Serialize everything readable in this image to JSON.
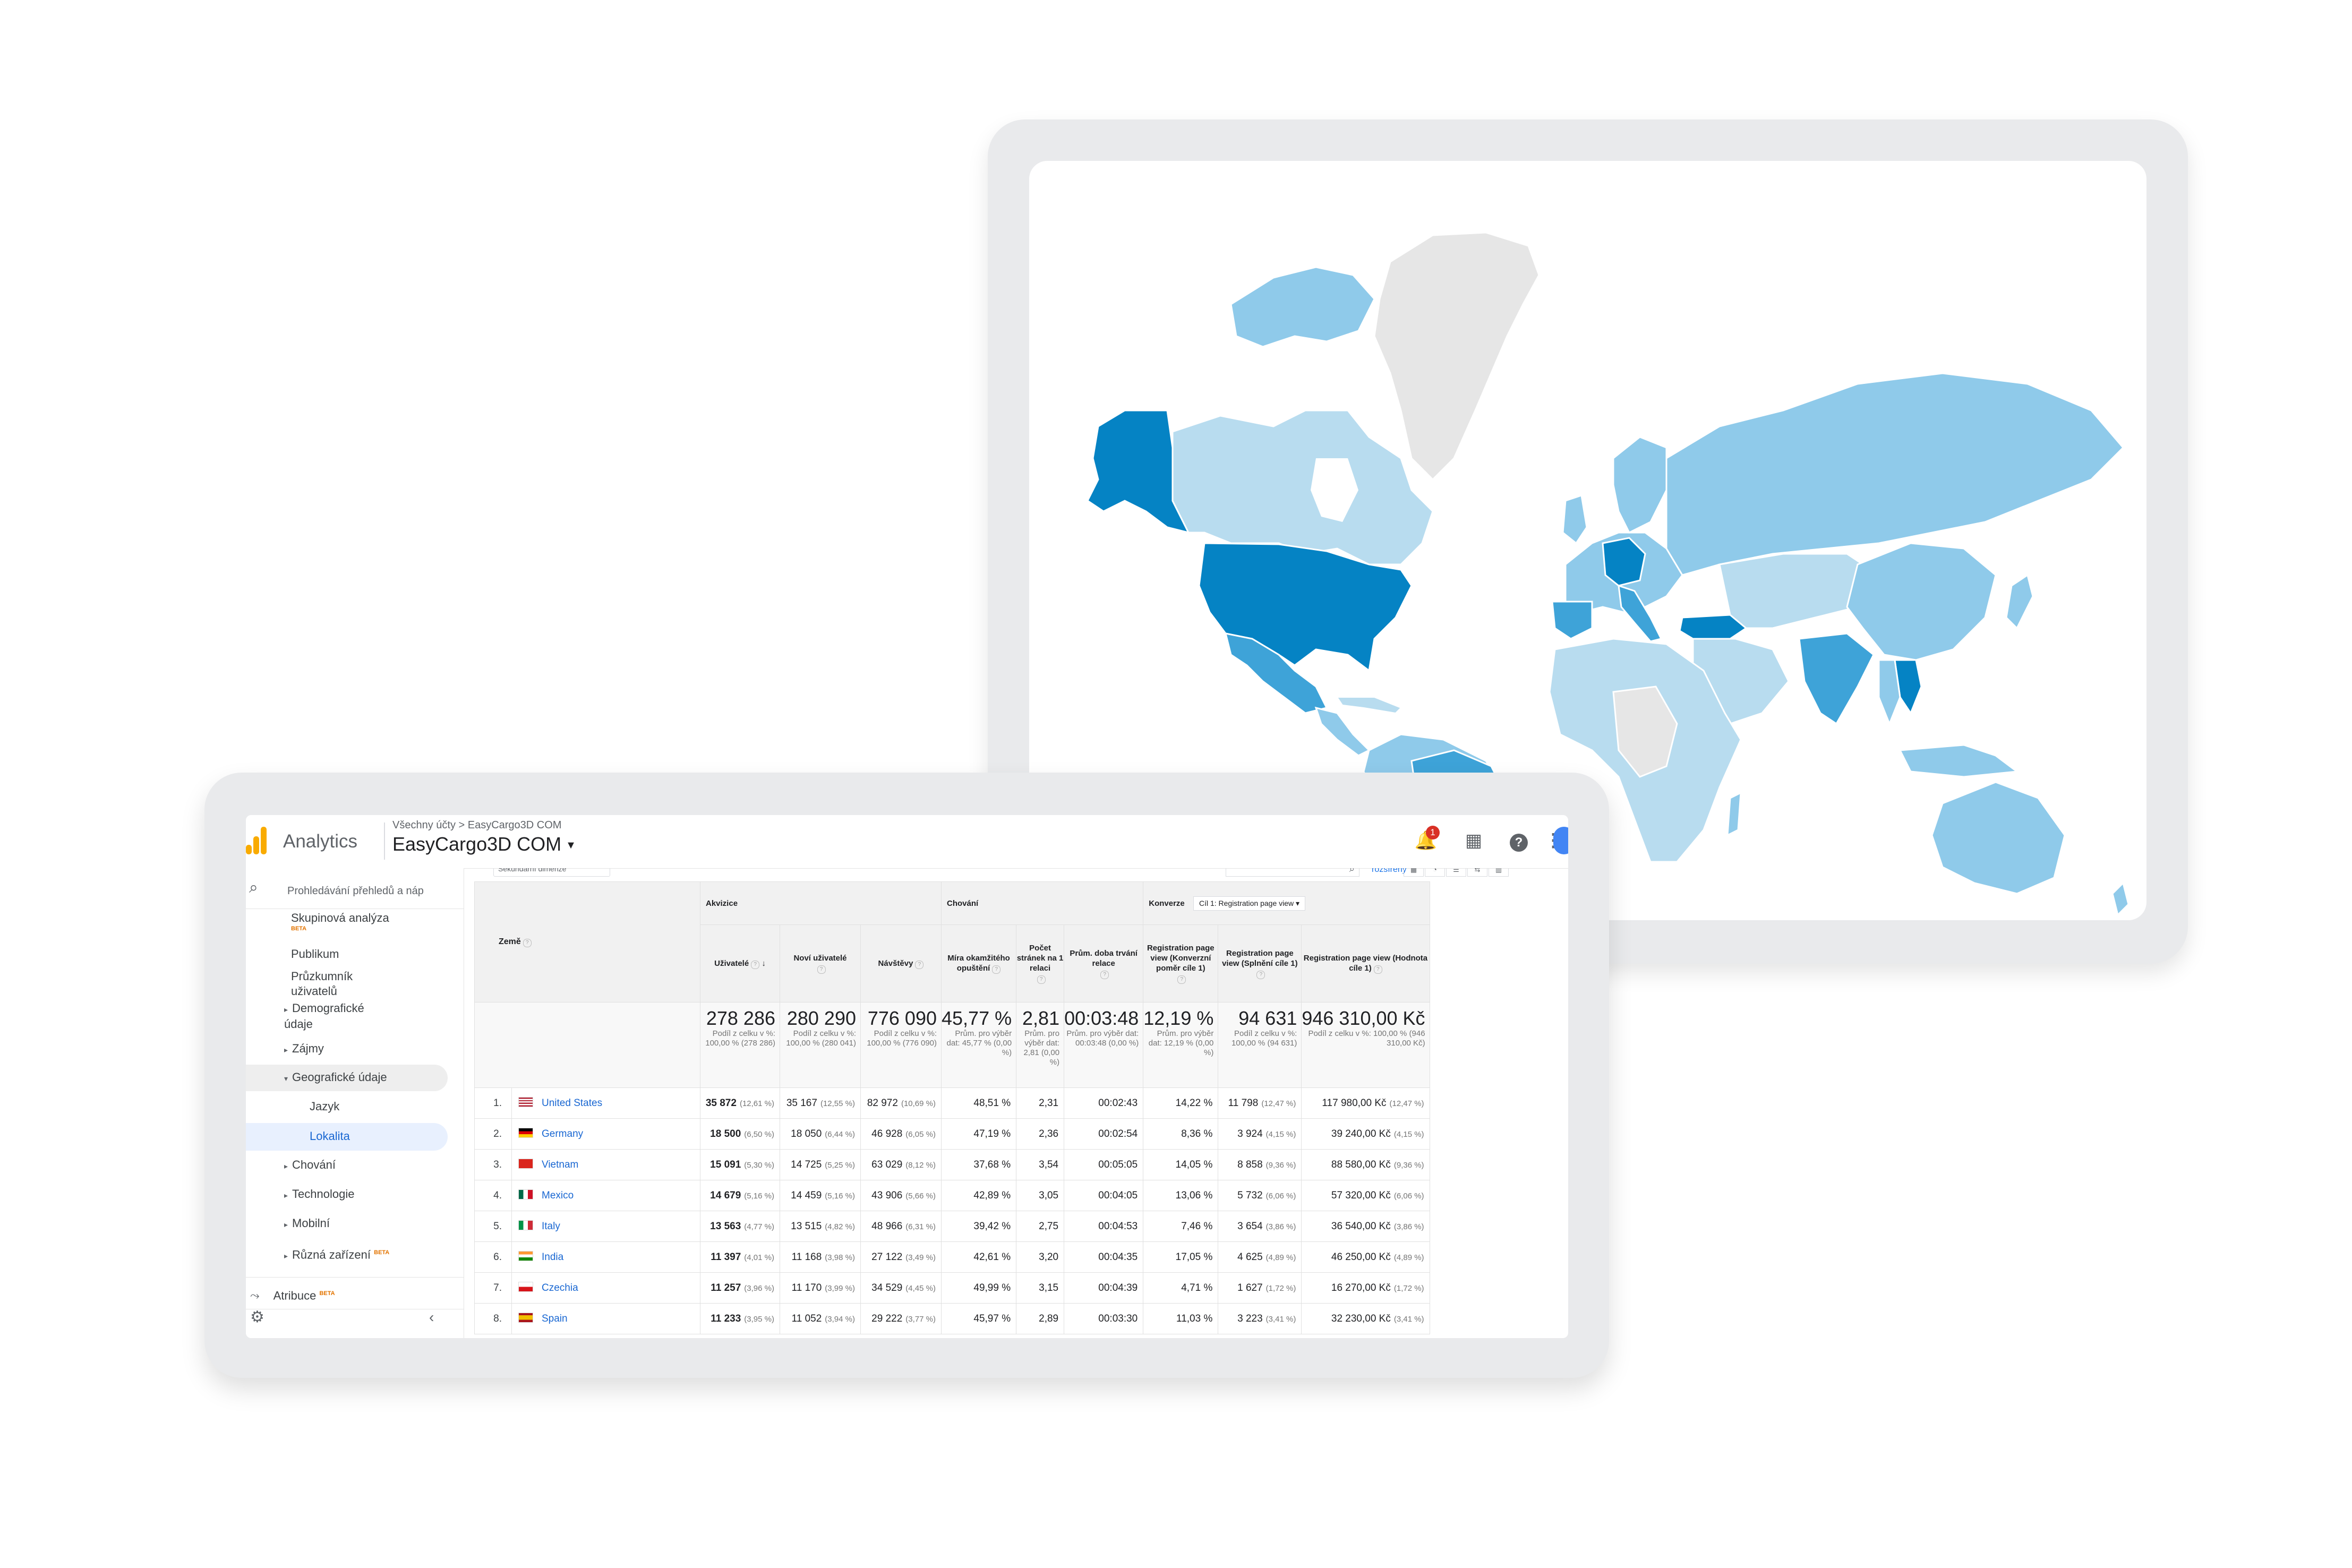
{
  "colors": {
    "map_ocean": "#ffffff",
    "map_nodata": "#e6e6e6",
    "map_light": "#b8dcef",
    "map_mid": "#8fcaea",
    "map_strong": "#3ea3d8",
    "map_max": "#0583c4",
    "ga_orange": "#f9ab00",
    "link_blue": "#1967d2"
  },
  "map": {
    "type": "choropleth-world",
    "highlighted_countries": [
      "United States",
      "Germany",
      "Vietnam",
      "Mexico",
      "Italy",
      "India",
      "Czechia",
      "Spain",
      "Turkey",
      "Brazil",
      "Canada",
      "Russia",
      "China",
      "Australia"
    ]
  },
  "header": {
    "app_name": "Analytics",
    "breadcrumb": "Všechny účty > EasyCargo3D COM",
    "account": "EasyCargo3D COM",
    "notification_count": "1",
    "icons": [
      "bell-icon",
      "apps-grid-icon",
      "help-icon",
      "more-vert-icon",
      "avatar"
    ]
  },
  "sidebar": {
    "search_placeholder": "Prohledávání přehledů a náp",
    "items": [
      {
        "label": "Skupinová analýza",
        "badge": "BETA"
      },
      {
        "label": "Publikum"
      },
      {
        "label": "Průzkumník uživatelů"
      },
      {
        "label": "Demografické údaje"
      },
      {
        "label": "Zájmy"
      },
      {
        "label": "Geografické údaje"
      },
      {
        "label": "Jazyk"
      },
      {
        "label": "Lokalita"
      },
      {
        "label": "Chování"
      },
      {
        "label": "Technologie"
      },
      {
        "label": "Mobilní"
      },
      {
        "label": "Různá zařízení",
        "badge": "BETA"
      },
      {
        "label": "Atribuce",
        "badge": "BETA"
      }
    ]
  },
  "controls": {
    "secondary_dimension": "Sekundární dimenze",
    "advanced": "rozšířený",
    "conversions_label": "Konverze",
    "goal_select": "Cíl 1: Registration page view"
  },
  "table": {
    "group_acquisition": "Akvizice",
    "group_behavior": "Chování",
    "col_country": "Země",
    "columns": [
      "Uživatelé",
      "Noví uživatelé",
      "Návštěvy",
      "Míra okamžitého opuštění",
      "Počet stránek na 1 relaci",
      "Prům. doba trvání relace",
      "Registration page view (Konverzní poměr cíle 1)",
      "Registration page view (Splnění cíle 1)",
      "Registration page view (Hodnota cíle 1)"
    ],
    "summary": [
      {
        "big": "278 286",
        "small": "Podíl z celku v %: 100,00 % (278 286)"
      },
      {
        "big": "280 290",
        "small": "Podíl z celku v %: 100,00 % (280 041)"
      },
      {
        "big": "776 090",
        "small": "Podíl z celku v %: 100,00 % (776 090)"
      },
      {
        "big": "45,77 %",
        "small": "Prům. pro výběr dat: 45,77 % (0,00 %)"
      },
      {
        "big": "2,81",
        "small": "Prům. pro výběr dat: 2,81 (0,00 %)"
      },
      {
        "big": "00:03:48",
        "small": "Prům. pro výběr dat: 00:03:48 (0,00 %)"
      },
      {
        "big": "12,19 %",
        "small": "Prům. pro výběr dat: 12,19 % (0,00 %)"
      },
      {
        "big": "94 631",
        "small": "Podíl z celku v %: 100,00 % (94 631)"
      },
      {
        "big": "946 310,00 Kč",
        "small": "Podíl z celku v %: 100,00 % (946 310,00 Kč)"
      }
    ],
    "rows": [
      {
        "rank": "1.",
        "country": "United States",
        "flag": "us",
        "users": "35 872",
        "users_pct": "(12,61 %)",
        "new": "35 167",
        "new_pct": "(12,55 %)",
        "sessions": "82 972",
        "sessions_pct": "(10,69 %)",
        "bounce": "48,51 %",
        "pages": "2,31",
        "duration": "00:02:43",
        "conv": "14,22 %",
        "compl": "11 798",
        "compl_pct": "(12,47 %)",
        "value": "117 980,00 Kč",
        "value_pct": "(12,47 %)"
      },
      {
        "rank": "2.",
        "country": "Germany",
        "flag": "de",
        "users": "18 500",
        "users_pct": "(6,50 %)",
        "new": "18 050",
        "new_pct": "(6,44 %)",
        "sessions": "46 928",
        "sessions_pct": "(6,05 %)",
        "bounce": "47,19 %",
        "pages": "2,36",
        "duration": "00:02:54",
        "conv": "8,36 %",
        "compl": "3 924",
        "compl_pct": "(4,15 %)",
        "value": "39 240,00 Kč",
        "value_pct": "(4,15 %)"
      },
      {
        "rank": "3.",
        "country": "Vietnam",
        "flag": "vn",
        "users": "15 091",
        "users_pct": "(5,30 %)",
        "new": "14 725",
        "new_pct": "(5,25 %)",
        "sessions": "63 029",
        "sessions_pct": "(8,12 %)",
        "bounce": "37,68 %",
        "pages": "3,54",
        "duration": "00:05:05",
        "conv": "14,05 %",
        "compl": "8 858",
        "compl_pct": "(9,36 %)",
        "value": "88 580,00 Kč",
        "value_pct": "(9,36 %)"
      },
      {
        "rank": "4.",
        "country": "Mexico",
        "flag": "mx",
        "users": "14 679",
        "users_pct": "(5,16 %)",
        "new": "14 459",
        "new_pct": "(5,16 %)",
        "sessions": "43 906",
        "sessions_pct": "(5,66 %)",
        "bounce": "42,89 %",
        "pages": "3,05",
        "duration": "00:04:05",
        "conv": "13,06 %",
        "compl": "5 732",
        "compl_pct": "(6,06 %)",
        "value": "57 320,00 Kč",
        "value_pct": "(6,06 %)"
      },
      {
        "rank": "5.",
        "country": "Italy",
        "flag": "it",
        "users": "13 563",
        "users_pct": "(4,77 %)",
        "new": "13 515",
        "new_pct": "(4,82 %)",
        "sessions": "48 966",
        "sessions_pct": "(6,31 %)",
        "bounce": "39,42 %",
        "pages": "2,75",
        "duration": "00:04:53",
        "conv": "7,46 %",
        "compl": "3 654",
        "compl_pct": "(3,86 %)",
        "value": "36 540,00 Kč",
        "value_pct": "(3,86 %)"
      },
      {
        "rank": "6.",
        "country": "India",
        "flag": "in",
        "users": "11 397",
        "users_pct": "(4,01 %)",
        "new": "11 168",
        "new_pct": "(3,98 %)",
        "sessions": "27 122",
        "sessions_pct": "(3,49 %)",
        "bounce": "42,61 %",
        "pages": "3,20",
        "duration": "00:04:35",
        "conv": "17,05 %",
        "compl": "4 625",
        "compl_pct": "(4,89 %)",
        "value": "46 250,00 Kč",
        "value_pct": "(4,89 %)"
      },
      {
        "rank": "7.",
        "country": "Czechia",
        "flag": "cz",
        "users": "11 257",
        "users_pct": "(3,96 %)",
        "new": "11 170",
        "new_pct": "(3,99 %)",
        "sessions": "34 529",
        "sessions_pct": "(4,45 %)",
        "bounce": "49,99 %",
        "pages": "3,15",
        "duration": "00:04:39",
        "conv": "4,71 %",
        "compl": "1 627",
        "compl_pct": "(1,72 %)",
        "value": "16 270,00 Kč",
        "value_pct": "(1,72 %)"
      },
      {
        "rank": "8.",
        "country": "Spain",
        "flag": "es",
        "users": "11 233",
        "users_pct": "(3,95 %)",
        "new": "11 052",
        "new_pct": "(3,94 %)",
        "sessions": "29 222",
        "sessions_pct": "(3,77 %)",
        "bounce": "45,97 %",
        "pages": "2,89",
        "duration": "00:03:30",
        "conv": "11,03 %",
        "compl": "3 223",
        "compl_pct": "(3,41 %)",
        "value": "32 230,00 Kč",
        "value_pct": "(3,41 %)"
      }
    ]
  }
}
